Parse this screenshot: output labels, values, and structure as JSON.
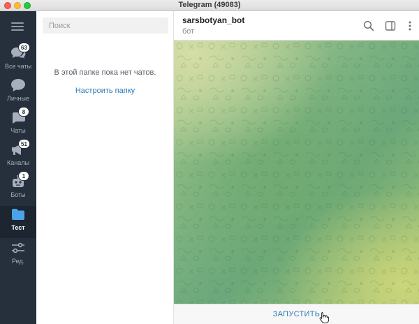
{
  "window": {
    "title": "Telegram (49083)"
  },
  "sidebar": {
    "menu_icon": "hamburger-icon",
    "folders": [
      {
        "label": "Все чаты",
        "badge": "63",
        "icon": "chat-bubbles-icon",
        "active": false
      },
      {
        "label": "Личные",
        "badge": "",
        "icon": "person-chat-icon",
        "active": false
      },
      {
        "label": "Чаты",
        "badge": "8",
        "icon": "group-chat-icon",
        "active": false
      },
      {
        "label": "Каналы",
        "badge": "51",
        "icon": "megaphone-icon",
        "active": false
      },
      {
        "label": "Боты",
        "badge": "1",
        "icon": "bot-icon",
        "active": false
      },
      {
        "label": "Тест",
        "badge": "",
        "icon": "folder-icon",
        "active": true
      },
      {
        "label": "Ред.",
        "badge": "",
        "icon": "sliders-icon",
        "active": false
      }
    ]
  },
  "chatlist": {
    "search_placeholder": "Поиск",
    "empty_text": "В этой папке пока нет чатов.",
    "setup_link": "Настроить папку"
  },
  "chat": {
    "peer_name": "sarsbotyan_bot",
    "peer_status": "бот",
    "start_button": "ЗАПУСТИТЬ"
  },
  "colors": {
    "sidebar_bg": "#26303c",
    "accent": "#2a7ab8",
    "chat_bg_green": "#6aa77b",
    "chat_bg_yellow": "#ced67a"
  }
}
